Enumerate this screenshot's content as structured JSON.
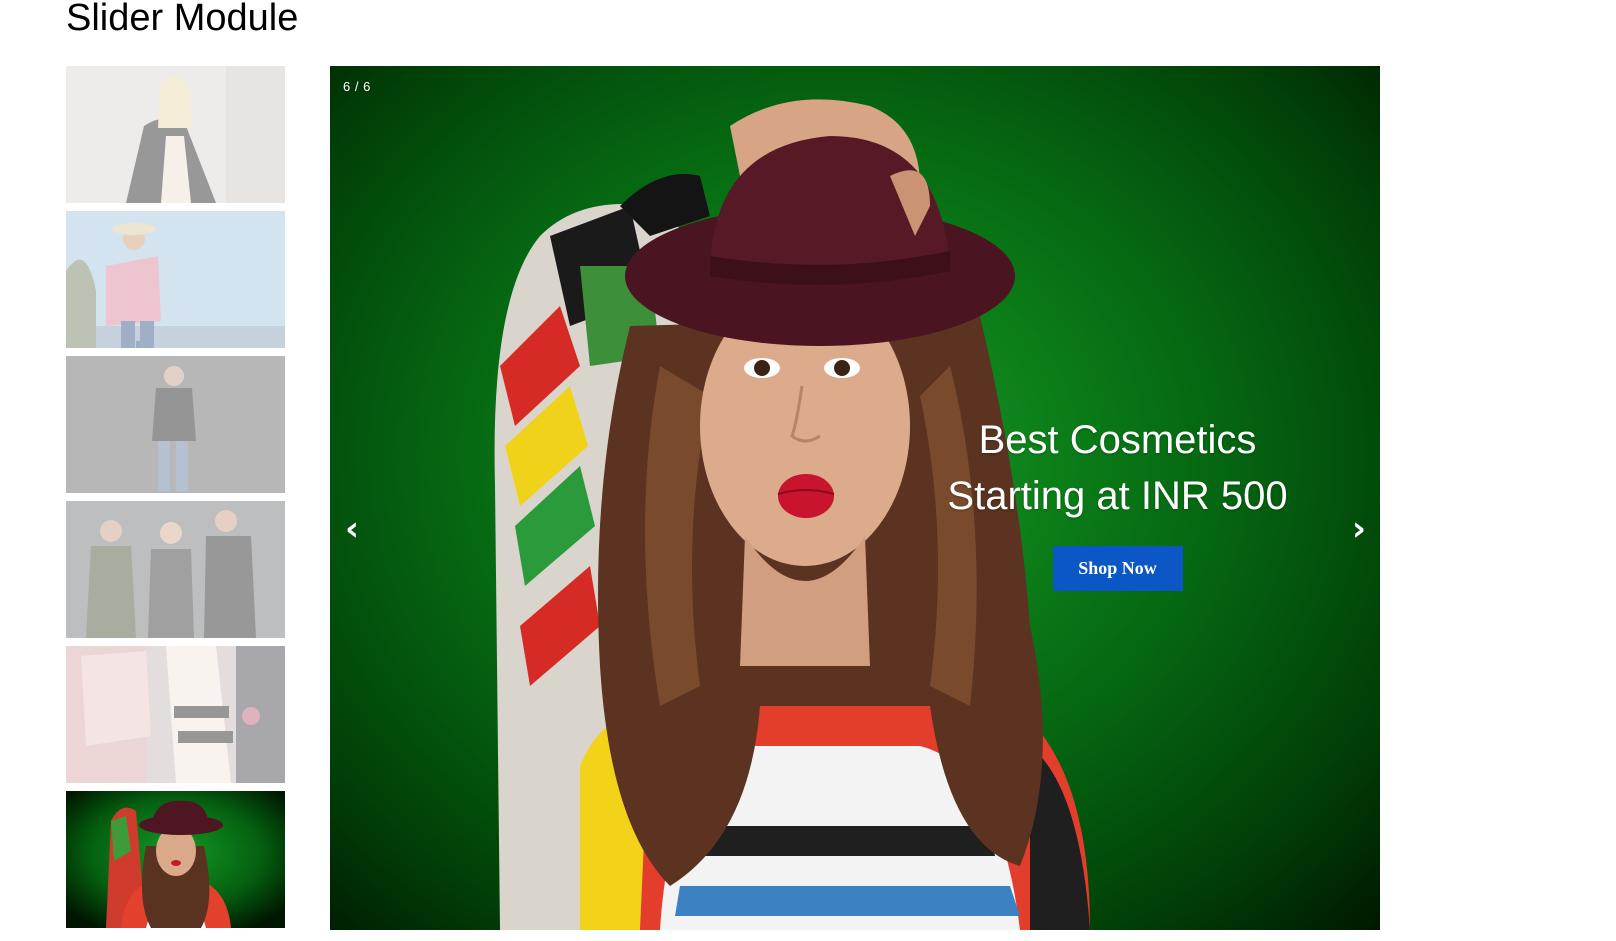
{
  "page": {
    "title": "Slider Module"
  },
  "slider": {
    "counter": "6 / 6",
    "prev_glyph": "‹",
    "next_glyph": "›",
    "caption": {
      "line1": "Best Cosmetics",
      "line2": "Starting at INR 500",
      "button_label": "Shop Now"
    },
    "colors": {
      "button": "#0b57c5",
      "background_green": "#0b7d18"
    },
    "active_index": 6,
    "total": 6
  },
  "thumbnails": [
    {
      "name": "thumbnail-1",
      "active": false
    },
    {
      "name": "thumbnail-2",
      "active": false
    },
    {
      "name": "thumbnail-3",
      "active": false
    },
    {
      "name": "thumbnail-4",
      "active": false
    },
    {
      "name": "thumbnail-5",
      "active": false
    },
    {
      "name": "thumbnail-6",
      "active": true
    }
  ]
}
